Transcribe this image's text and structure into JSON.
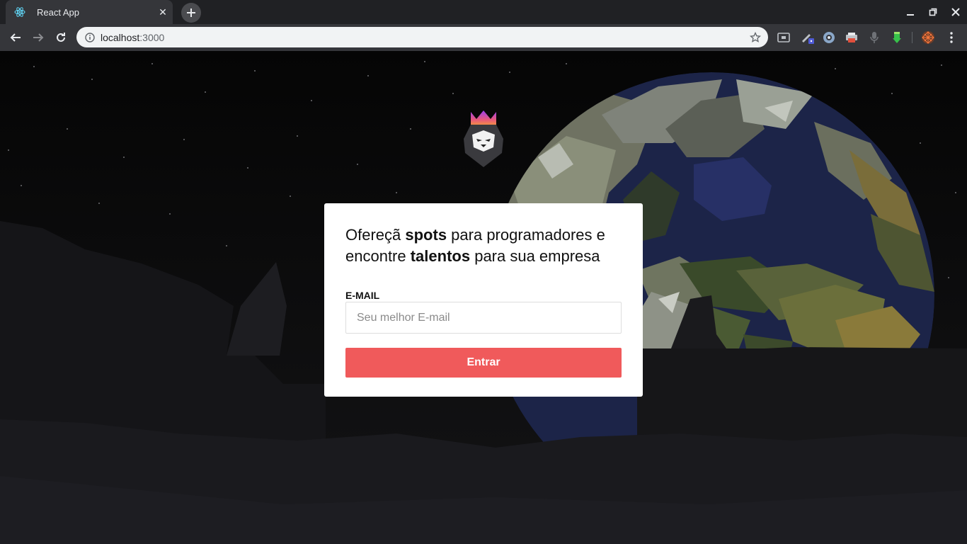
{
  "browser": {
    "tab": {
      "title": "React App",
      "favicon": "react-icon"
    },
    "address": {
      "host": "localhost",
      "port": ":3000"
    },
    "extensions": [
      "cast-icon",
      "pen-extension-icon",
      "record-extension-icon",
      "printer-extension-icon",
      "mic-extension-icon",
      "download-extension-icon",
      "avatar-extension-icon"
    ]
  },
  "colors": {
    "primary_button": "#f05a5b",
    "card_background": "#ffffff",
    "page_background": "#0a0a0b"
  },
  "form": {
    "headline": {
      "part1": "Ofereçã ",
      "strong1": "spots",
      "part2": " para programadores e encontre ",
      "strong2": "talentos",
      "part3": " para sua empresa"
    },
    "email_label": "E-MAIL",
    "email_placeholder": "Seu melhor E-mail",
    "email_value": "",
    "submit_label": "Entrar"
  }
}
